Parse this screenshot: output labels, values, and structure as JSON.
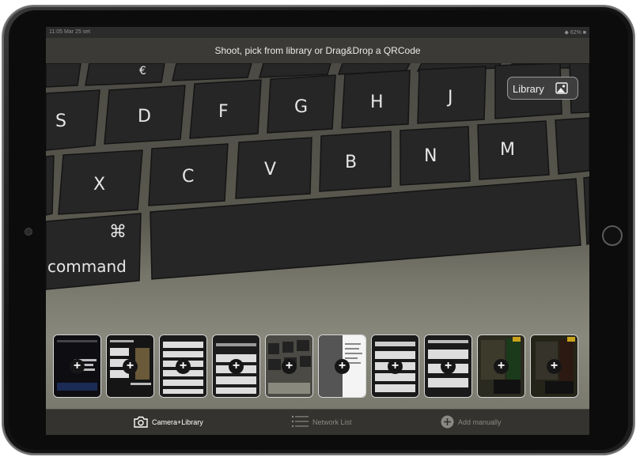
{
  "status_bar": {
    "time": "11:05",
    "date": "Mar 25 set",
    "right": "◆ 62% ■"
  },
  "header": {
    "title": "Shoot, pick from library or Drag&Drop a QRCode"
  },
  "viewfinder": {
    "keys": [
      "€",
      "S",
      "D",
      "F",
      "G",
      "H",
      "J",
      "X",
      "C",
      "V",
      "B",
      "N",
      "M",
      "⌘",
      "command"
    ]
  },
  "library_button": {
    "label": "Library",
    "icon": "photo-icon"
  },
  "thumbnails": {
    "count": 10,
    "add_icon": "+"
  },
  "tab_bar": {
    "tabs": [
      {
        "label": "Camera+Library",
        "icon": "camera-icon",
        "active": true
      },
      {
        "label": "Network List",
        "icon": "list-icon",
        "active": false
      },
      {
        "label": "Add manually",
        "icon": "plus-circle-icon",
        "active": false
      }
    ]
  },
  "colors": {
    "active_tab": "#ffffff",
    "inactive_tab": "#8a8a84",
    "bar": "#3b3a36"
  }
}
